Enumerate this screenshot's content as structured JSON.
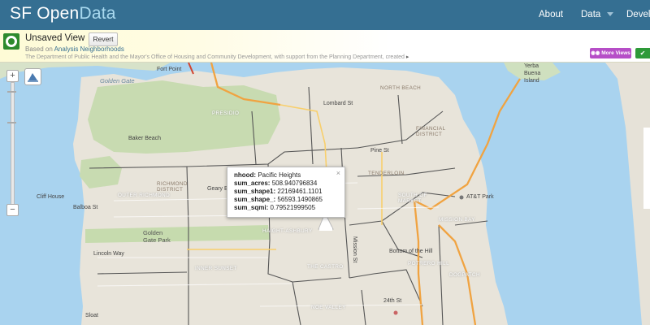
{
  "header": {
    "brand_part1": "SF Open",
    "brand_part2": "Data",
    "nav": [
      {
        "label": "About"
      },
      {
        "label": "Data"
      },
      {
        "label": "Devel"
      }
    ]
  },
  "view": {
    "title": "Unsaved View",
    "revert_label": "Revert",
    "based_on_prefix": "Based on",
    "based_on_link": "Analysis Neighborhoods",
    "description": "The Department of Public Health and the Mayor's Office of Housing and Community Development, with support from the Planning Department, created",
    "more_views_label": "More Views",
    "share_label": "✔"
  },
  "map": {
    "zoom_in": "+",
    "zoom_out": "−",
    "labels": {
      "golden_gate": "Golden Gate",
      "fort_point": "Fort Point",
      "baker_beach": "Baker Beach",
      "cliff_house": "Cliff House",
      "yerba_buena": "Yerba Buena Island",
      "lombard": "Lombard St",
      "north_beach": "NORTH BEACH",
      "financial": "FINANCIAL DISTRICT",
      "pine": "Pine St",
      "tenderloin": "TENDERLOIN",
      "south_market": "SOUTH OF MARKET",
      "att": "AT&T Park",
      "mission_bay": "MISSION BAY",
      "richmond": "RICHMOND DISTRICT",
      "outer_richmond": "OUTER RICHMOND",
      "geary": "Geary Bl",
      "balboa": "Balboa St",
      "gg_park": "Golden Gate Park",
      "inner_sunset": "INNER SUNSET",
      "castro": "THE CASTRO",
      "noe": "NOE VALLEY",
      "bottom_hill": "Bottom of the Hill",
      "potrero": "POTRERO HILL",
      "dogpatch": "DOGPATCH",
      "presidio": "PRESIDIO",
      "haight": "HAIGHT-ASHBURY",
      "lincoln": "Lincoln Way",
      "s24": "24th St",
      "mission": "Mission St",
      "sloat": "Sloat"
    }
  },
  "popup": {
    "close": "×",
    "rows": [
      {
        "key": "nhood:",
        "value": "Pacific Heights"
      },
      {
        "key": "sum_acres:",
        "value": "508.940796834"
      },
      {
        "key": "sum_shape1:",
        "value": "22169461.1101"
      },
      {
        "key": "sum_shape_:",
        "value": "56593.1490865"
      },
      {
        "key": "sum_sqmi:",
        "value": "0.79521999505"
      }
    ]
  }
}
